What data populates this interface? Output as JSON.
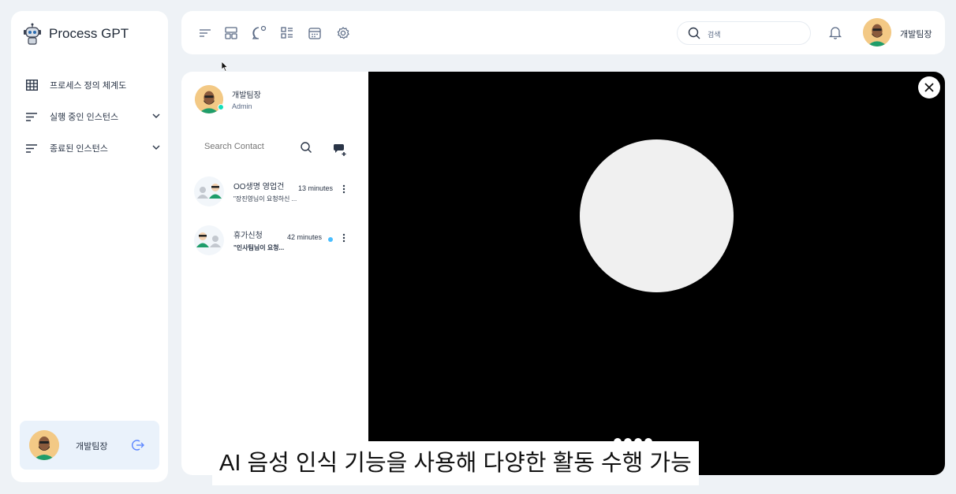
{
  "brand": {
    "name": "Process GPT"
  },
  "sidebar": {
    "items": [
      {
        "label": "프로세스 정의 체계도",
        "icon": "grid-icon",
        "expandable": false
      },
      {
        "label": "실행 중인 인스턴스",
        "icon": "list-icon",
        "expandable": true
      },
      {
        "label": "종료된 인스턴스",
        "icon": "list-icon",
        "expandable": true
      }
    ],
    "profile": {
      "name": "개발팀장"
    }
  },
  "topbar": {
    "icons": [
      "menu-icon",
      "layout-icon",
      "chat-bubble-icon",
      "checklist-icon",
      "calendar-icon",
      "settings-icon"
    ],
    "search_placeholder": "검색",
    "user_name": "개발팀장"
  },
  "chat": {
    "me": {
      "name": "개발팀장",
      "role": "Admin"
    },
    "search_placeholder": "Search Contact",
    "conversations": [
      {
        "title": "OO생명 영업건",
        "preview": "\"장진영님이 요청하신 ...",
        "time": "13 minutes",
        "unread": false
      },
      {
        "title": "휴가신청",
        "preview": "\"인사팀님이 요청...",
        "time": "42 minutes",
        "unread": true
      }
    ]
  },
  "caption": "AI 음성 인식 기능을 사용해 다양한 활동 수행 가능",
  "colors": {
    "accent": "#5d87ff",
    "online": "#13deb9",
    "unread": "#49beff",
    "sidebar_active_bg": "#eaf2fb",
    "overlay": "#000000"
  }
}
